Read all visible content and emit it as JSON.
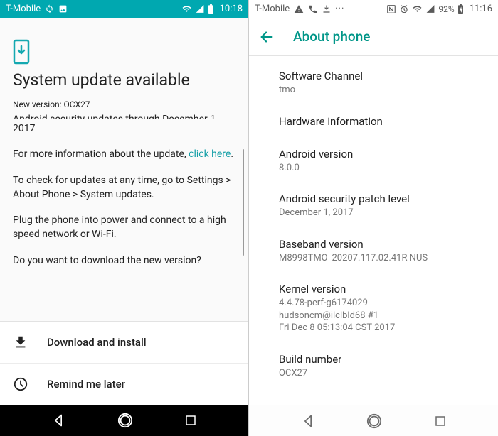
{
  "left": {
    "status": {
      "carrier": "T-Mobile",
      "clock": "10:18"
    },
    "heading": "System update available",
    "new_version": "New version: OCX27",
    "cutoff_top": "Android security updates through December 1,",
    "cutoff_top2": "2017",
    "para_info_pre": "For more information about the update, ",
    "para_info_link": "click here",
    "para_info_post": ".",
    "para_check": "To check for updates at any time, go to Settings > About Phone > System updates.",
    "para_plug": "Plug the phone into power and connect to a high speed network or Wi-Fi.",
    "para_ask": "Do you want to download the new version?",
    "action_download": "Download and install",
    "action_remind": "Remind me later"
  },
  "right": {
    "status": {
      "carrier": "T-Mobile",
      "battery": "92%",
      "clock": "11:16"
    },
    "header_title": "About phone",
    "items": [
      {
        "k": "Software Channel",
        "v": "tmo"
      },
      {
        "k": "Hardware information",
        "v": ""
      },
      {
        "k": "Android version",
        "v": "8.0.0"
      },
      {
        "k": "Android security patch level",
        "v": "December 1, 2017"
      },
      {
        "k": "Baseband version",
        "v": "M8998TMO_20207.117.02.41R NUS"
      },
      {
        "k": "Kernel version",
        "v": "4.4.78-perf-g6174029\nhudsoncm@ilclbld68 #1\nFri Dec 8 05:13:04 CST 2017"
      },
      {
        "k": "Build number",
        "v": "OCX27"
      }
    ]
  }
}
